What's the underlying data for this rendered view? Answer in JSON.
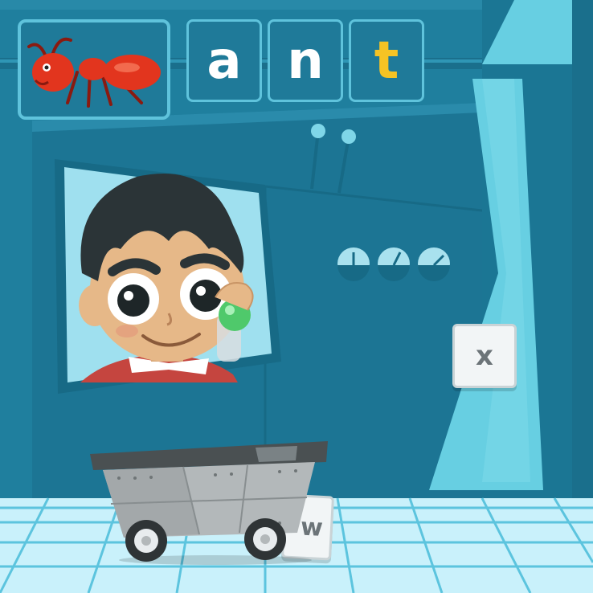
{
  "word": {
    "letters": [
      {
        "char": "a",
        "color": "#ffffff"
      },
      {
        "char": "n",
        "color": "#ffffff"
      },
      {
        "char": "t",
        "color": "#f6c324"
      }
    ]
  },
  "picture_card": {
    "icon": "ant-icon"
  },
  "keys": {
    "wall_key": "x",
    "cart_key": "w"
  },
  "gauges": {
    "count": 3
  },
  "colors": {
    "wall": "#1f7f9e",
    "tile_border": "#5fc3dc",
    "highlight_letter": "#f6c324",
    "floor": "#c9f1fb"
  }
}
